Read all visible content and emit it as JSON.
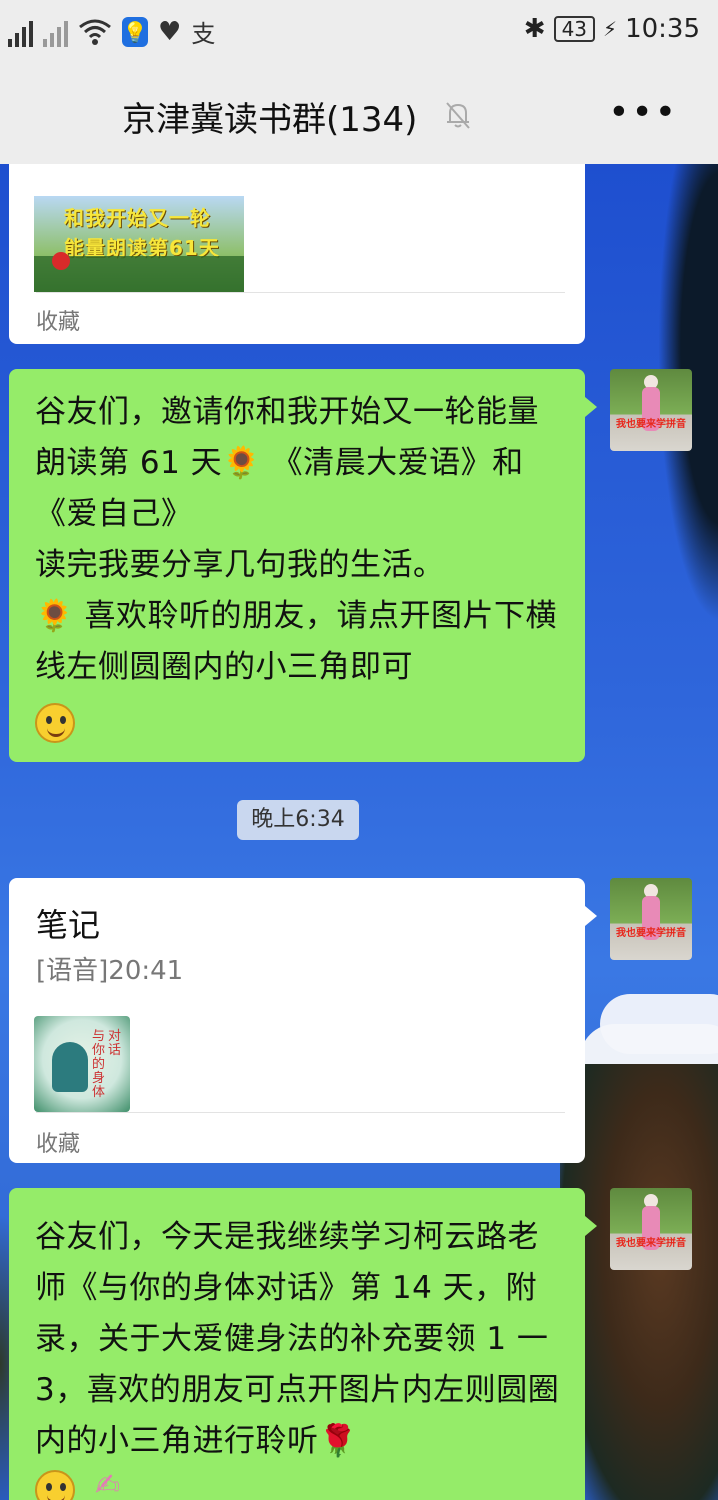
{
  "status_bar": {
    "battery": "43",
    "time": "10:35",
    "icons": [
      "signal-icon",
      "no-signal-icon",
      "wifi-icon",
      "bulb-icon",
      "heart-icon",
      "alipay-icon",
      "bluetooth-icon",
      "charging-icon"
    ]
  },
  "header": {
    "title": "京津冀读书群(134)",
    "more_label": "•••"
  },
  "messages": {
    "card1": {
      "thumb_line1": "和我开始又一轮",
      "thumb_line2": "能量朗读第61天",
      "collect_label": "收藏"
    },
    "bubble1": {
      "text": "谷友们，邀请你和我开始又一轮能量朗读第 61 天🌻 《清晨大爱语》和《爱自己》\n读完我要分享几句我的生活。\n🌻 喜欢聆听的朋友，请点开图片下横线左侧圆圈内的小三角即可"
    },
    "timestamp": "晚上6:34",
    "card2": {
      "title": "笔记",
      "subtitle": "[语音]20:41",
      "thumb_text1": "与你的身体",
      "thumb_text2": "对话",
      "collect_label": "收藏"
    },
    "bubble2": {
      "text": "谷友们，今天是我继续学习柯云路老师《与你的身体对话》第 14 天，附录，关于大爱健身法的补充要领 1 一 3，喜欢的朋友可点开图片内左则圆圈内的小三角进行聆听🌹"
    },
    "avatar_banner": "我也要来学拼音"
  }
}
